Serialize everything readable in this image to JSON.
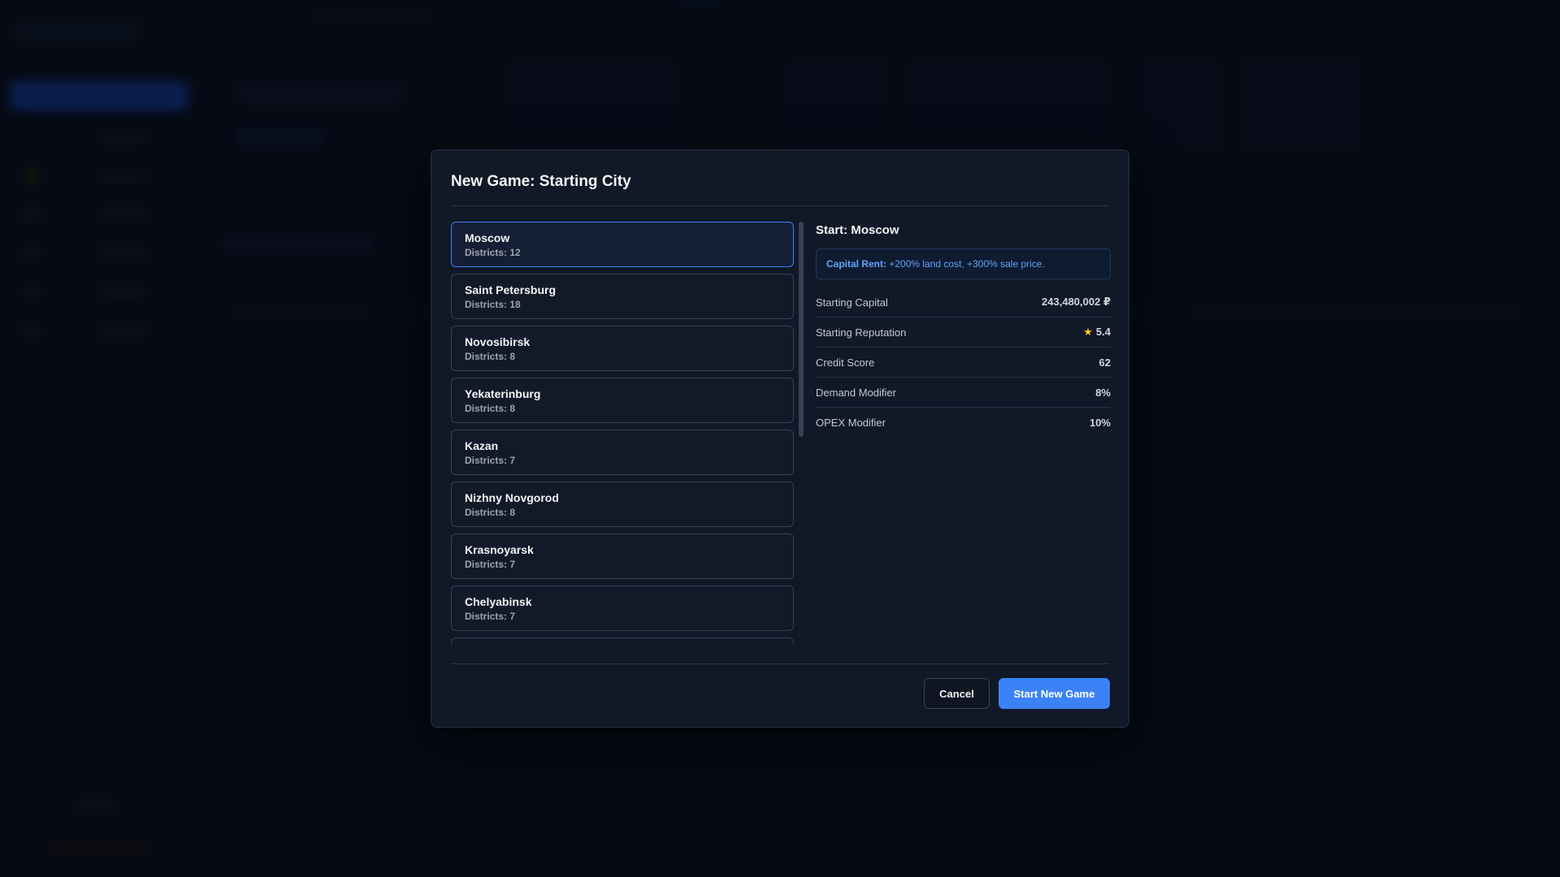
{
  "modal": {
    "title": "New Game: Starting City",
    "cities": [
      {
        "name": "Moscow",
        "districts": "Districts: 12",
        "selected": true
      },
      {
        "name": "Saint Petersburg",
        "districts": "Districts: 18",
        "selected": false
      },
      {
        "name": "Novosibirsk",
        "districts": "Districts: 8",
        "selected": false
      },
      {
        "name": "Yekaterinburg",
        "districts": "Districts: 8",
        "selected": false
      },
      {
        "name": "Kazan",
        "districts": "Districts: 7",
        "selected": false
      },
      {
        "name": "Nizhny Novgorod",
        "districts": "Districts: 8",
        "selected": false
      },
      {
        "name": "Krasnoyarsk",
        "districts": "Districts: 7",
        "selected": false
      },
      {
        "name": "Chelyabinsk",
        "districts": "Districts: 7",
        "selected": false
      }
    ],
    "details": {
      "title": "Start: Moscow",
      "rent_label": "Capital Rent:",
      "rent_text": "+200% land cost, +300% sale price.",
      "stats": [
        {
          "label": "Starting Capital",
          "value": "243,480,002 ₽"
        },
        {
          "label": "Starting Reputation",
          "value": "5.4",
          "icon": "star-icon"
        },
        {
          "label": "Credit Score",
          "value": "62"
        },
        {
          "label": "Demand Modifier",
          "value": "8%"
        },
        {
          "label": "OPEX Modifier",
          "value": "10%"
        }
      ]
    },
    "buttons": {
      "cancel": "Cancel",
      "start": "Start New Game"
    }
  },
  "colors": {
    "accent": "#3b82f6",
    "star": "#facc15",
    "rent_text": "#60a5fa"
  }
}
